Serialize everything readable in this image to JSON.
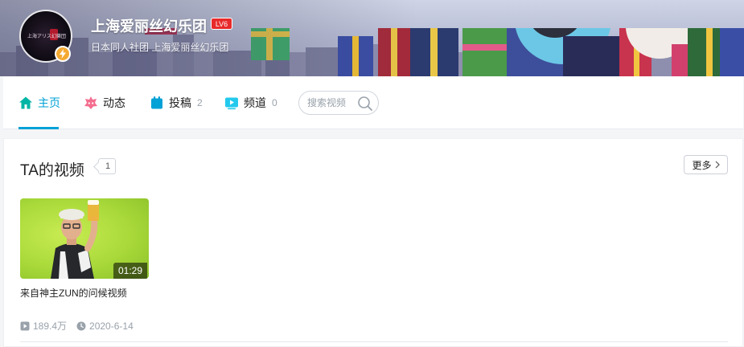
{
  "header": {
    "username": "上海爱丽丝幻乐团",
    "level": "LV6",
    "sign": "日本同人社团 上海爱丽丝幻乐团",
    "avatar_text": "上海アリス幻樂団"
  },
  "nav": {
    "items": [
      {
        "label": "主页",
        "icon": "home-icon",
        "count": ""
      },
      {
        "label": "动态",
        "icon": "dynamic-icon",
        "count": ""
      },
      {
        "label": "投稿",
        "icon": "upload-icon",
        "count": "2"
      },
      {
        "label": "频道",
        "icon": "channel-icon",
        "count": "0"
      }
    ],
    "search_placeholder": "搜索视频"
  },
  "videos_section": {
    "title": "TA的视频",
    "count": "1",
    "more_label": "更多",
    "videos": [
      {
        "title": "来自神主ZUN的问候视频",
        "duration": "01:29",
        "views": "189.4万",
        "date": "2020-6-14"
      }
    ]
  },
  "colors": {
    "accent": "#00a1d6",
    "level_badge": "#e82a2a",
    "verify": "#f4a932"
  }
}
